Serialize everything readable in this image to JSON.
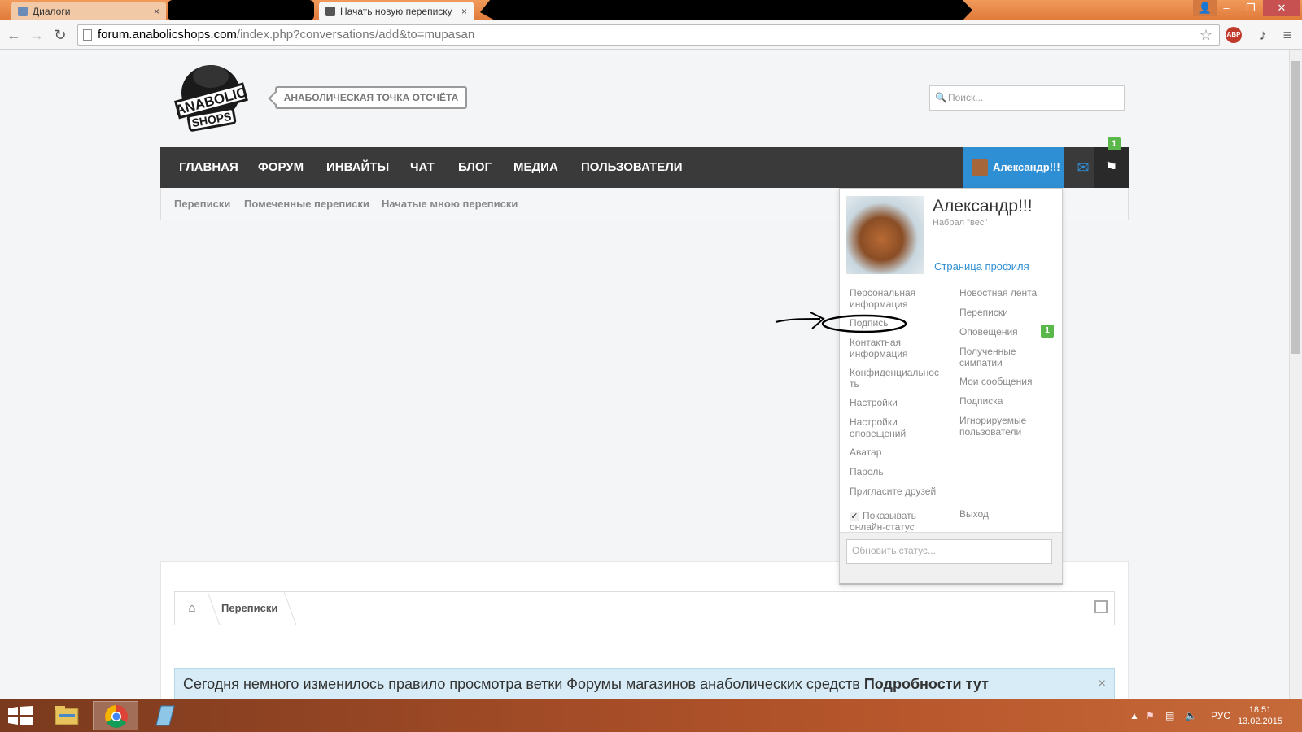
{
  "browser": {
    "tabs": [
      {
        "label": "Диалоги",
        "close": "×"
      },
      {
        "label": "Начать новую переписку",
        "close": "×"
      }
    ],
    "url_host": "forum.anabolicshops.com",
    "url_path": "/index.php?conversations/add&to=mupasan",
    "window_controls": {
      "minimize": "–",
      "restore": "❐",
      "close": "✕"
    }
  },
  "site": {
    "logo_text_1": "ANABOLIC",
    "logo_text_2": "SHOPS",
    "tagline": "АНАБОЛИЧЕСКАЯ ТОЧКА ОТСЧЁТА",
    "search_placeholder": "Поиск...",
    "nav": [
      "ГЛАВНАЯ",
      "ФОРУМ",
      "ИНВАЙТЫ",
      "ЧАТ",
      "БЛОГ",
      "МЕДИА",
      "ПОЛЬЗОВАТЕЛИ"
    ],
    "user_tab": "Александр!!!",
    "alerts_badge": "1",
    "subnav": [
      "Переписки",
      "Помеченные переписки",
      "Начатые мною переписки"
    ]
  },
  "dropdown": {
    "name": "Александр!!!",
    "user_title": "Набрал \"вес\"",
    "profile_link": "Страница профиля",
    "left_links": [
      "Персональная информация",
      "Подпись",
      "Контактная информация",
      "Конфиденциальность",
      "Настройки",
      "Настройки оповещений",
      "Аватар",
      "Пароль",
      "Пригласите друзей"
    ],
    "right_links": [
      "Новостная лента",
      "Переписки",
      "Оповещения",
      "Полученные симпатии",
      "Мои сообщения",
      "Подписка",
      "Игнорируемые пользователи"
    ],
    "alerts_count": "1",
    "online_status_label": "Показывать онлайн-статус",
    "online_status_checked": true,
    "logout": "Выход",
    "status_placeholder": "Обновить статус..."
  },
  "content": {
    "breadcrumb": [
      "Переписки"
    ],
    "notice_text": "Сегодня немного изменилось правило просмотра ветки Форумы магазинов анаболических средств",
    "notice_link": "Подробности тут",
    "notice_close": "×"
  },
  "taskbar": {
    "tray_lang": "РУС",
    "time": "18:51",
    "date": "13.02.2015"
  },
  "colors": {
    "nav_bg": "#3a3a3a",
    "accent": "#2f8fd5",
    "badge_green": "#5ab74a",
    "notice_bg": "#d7ecf6"
  }
}
